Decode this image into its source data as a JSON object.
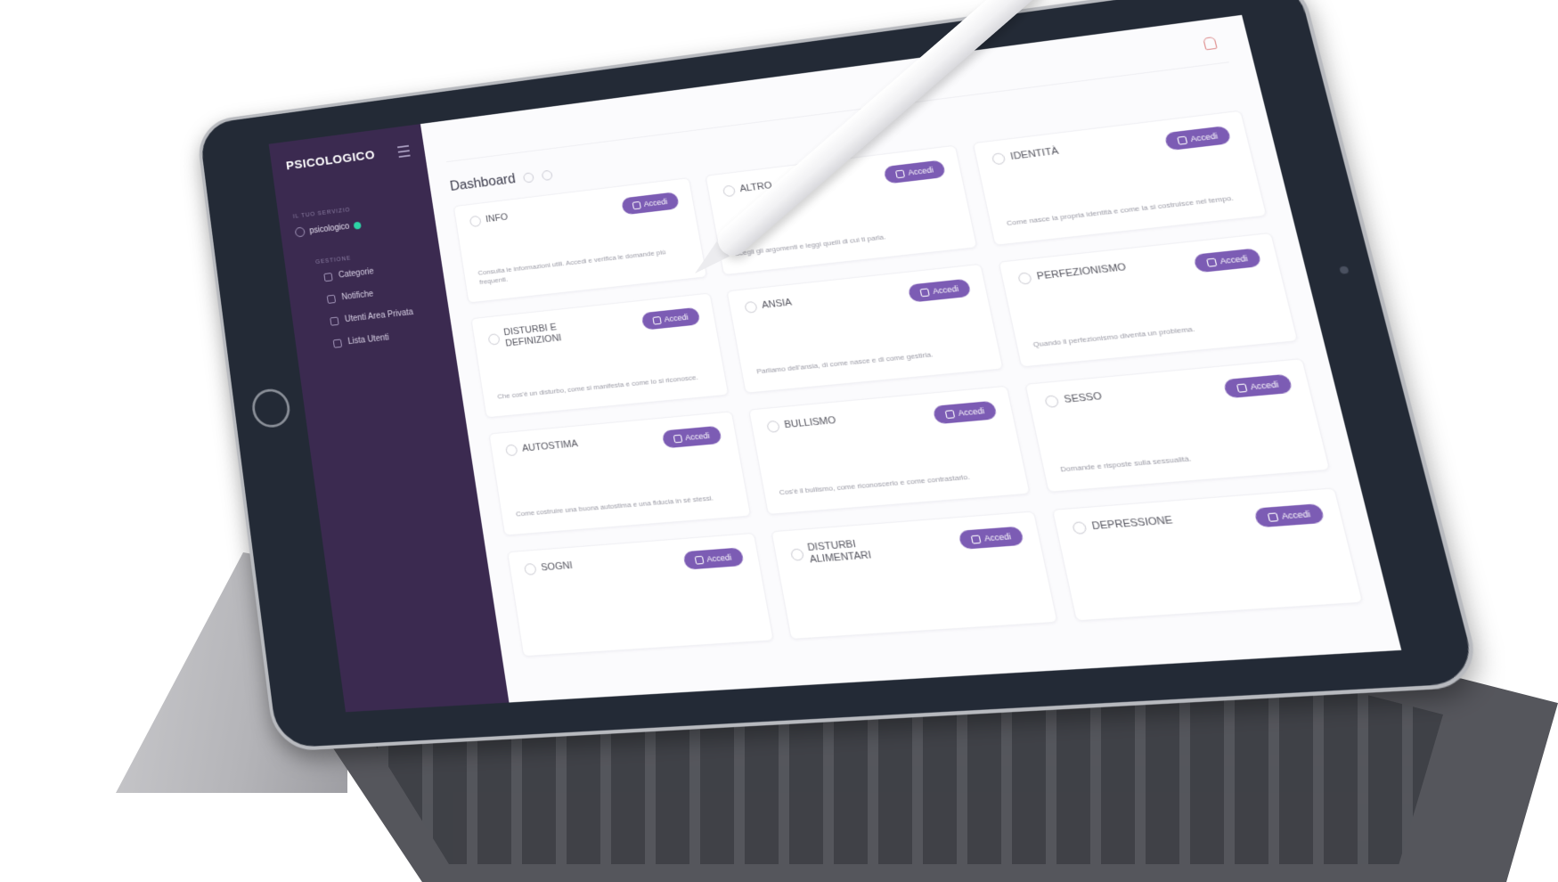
{
  "sidebar": {
    "brand": "PSICOLOGICO",
    "user_section": "IL TUO SERVIZIO",
    "user_name": "psicologico",
    "nav_section": "GESTIONE",
    "items": [
      {
        "label": "Categorie"
      },
      {
        "label": "Notifiche"
      },
      {
        "label": "Utenti Area Privata"
      },
      {
        "label": "Lista Utenti"
      }
    ]
  },
  "main": {
    "title": "Dashboard",
    "cards": [
      {
        "title": "INFO",
        "button": "Accedi",
        "text": "Consulta le informazioni utili. Accedi e verifica le domande più frequenti."
      },
      {
        "title": "ALTRO",
        "button": "Accedi",
        "text": "Scegli gli argomenti e leggi quelli di cui ti parla."
      },
      {
        "title": "IDENTITÀ",
        "button": "Accedi",
        "text": "Come nasce la propria identità e come la si costruisce nel tempo."
      },
      {
        "title": "DISTURBI E DEFINIZIONI",
        "button": "Accedi",
        "text": "Che cos'è un disturbo, come si manifesta e come lo si riconosce."
      },
      {
        "title": "ANSIA",
        "button": "Accedi",
        "text": "Parliamo dell'ansia, di come nasce e di come gestirla."
      },
      {
        "title": "PERFEZIONISMO",
        "button": "Accedi",
        "text": "Quando il perfezionismo diventa un problema."
      },
      {
        "title": "AUTOSTIMA",
        "button": "Accedi",
        "text": "Come costruire una buona autostima e una fiducia in sé stessi."
      },
      {
        "title": "BULLISMO",
        "button": "Accedi",
        "text": "Cos'è il bullismo, come riconoscerlo e come contrastarlo."
      },
      {
        "title": "SESSO",
        "button": "Accedi",
        "text": "Domande e risposte sulla sessualità."
      },
      {
        "title": "SOGNI",
        "button": "Accedi",
        "text": ""
      },
      {
        "title": "DISTURBI ALIMENTARI",
        "button": "Accedi",
        "text": ""
      },
      {
        "title": "DEPRESSIONE",
        "button": "Accedi",
        "text": ""
      }
    ]
  },
  "colors": {
    "sidebar": "#3b2a50",
    "accent": "#7c5cb4",
    "status_dot": "#2dd4a6",
    "bezel": "#232a36"
  },
  "icons": [
    "hamburger-icon",
    "user-icon",
    "status-dot",
    "nav-icon",
    "bell-icon",
    "card-icon",
    "enter-icon"
  ]
}
